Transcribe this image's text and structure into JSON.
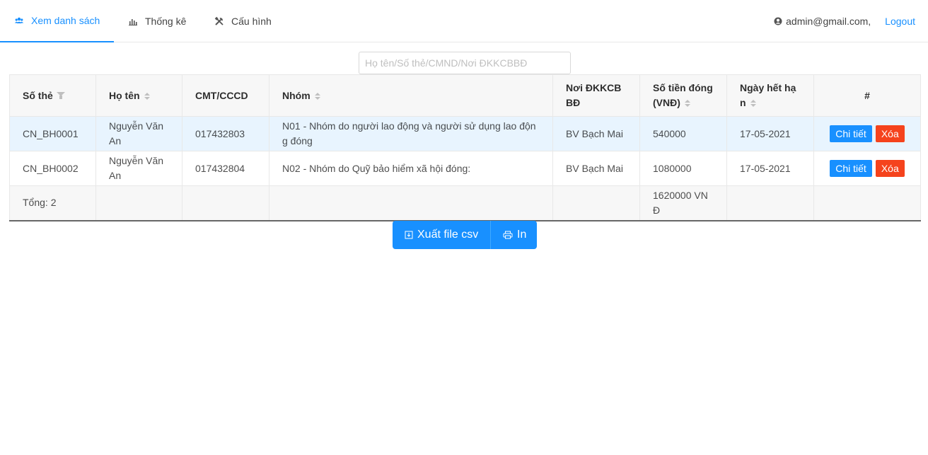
{
  "nav": {
    "items": [
      {
        "label": "Xem danh sách",
        "icon": "team-icon"
      },
      {
        "label": "Thống kê",
        "icon": "bar-chart-icon"
      },
      {
        "label": "Cấu hình",
        "icon": "tools-icon"
      }
    ],
    "user_email": "admin@gmail.com,",
    "logout": "Logout"
  },
  "search": {
    "placeholder": "Họ tên/Số thẻ/CMND/Nơi ĐKKCBBĐ",
    "value": ""
  },
  "table": {
    "columns": [
      "Số thẻ",
      "Họ tên",
      "CMT/CCCD",
      "Nhóm",
      "Nơi ĐKKCB BĐ",
      "Số tiền đóng (VNĐ)",
      "Ngày hết hạn",
      "#"
    ],
    "rows": [
      {
        "so_the": "CN_BH0001",
        "ho_ten": "Nguyễn Văn An",
        "cmt": "017432803",
        "nhom": "N01 - Nhóm do người lao động và người sử dụng lao động đóng",
        "noi_dk": "BV Bạch Mai",
        "so_tien": "540000",
        "ngay_het_han": "17-05-2021"
      },
      {
        "so_the": "CN_BH0002",
        "ho_ten": "Nguyễn Văn An",
        "cmt": "017432804",
        "nhom": "N02 - Nhóm do Quỹ bảo hiểm xã hội đóng:",
        "noi_dk": "BV Bạch Mai",
        "so_tien": "1080000",
        "ngay_het_han": "17-05-2021"
      }
    ],
    "action_detail": "Chi tiết",
    "action_delete": "Xóa",
    "footer": {
      "total_label": "Tổng: 2",
      "total_amount": "1620000 VNĐ"
    }
  },
  "buttons": {
    "export_csv": "Xuất file csv",
    "print": "In"
  },
  "colors": {
    "primary": "#1890ff",
    "danger": "#f5431d",
    "row_highlight": "#e8f4fe"
  }
}
